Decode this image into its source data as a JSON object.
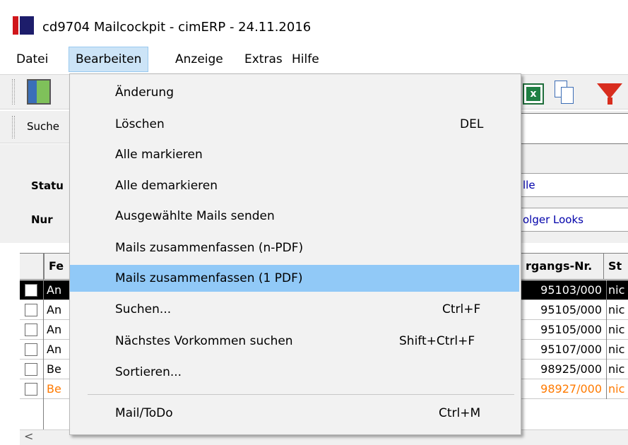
{
  "window": {
    "title": "cd9704 Mailcockpit - cimERP - 24.11.2016"
  },
  "menubar": {
    "items": [
      "Datei",
      "Bearbeiten",
      "Anzeige",
      "Extras",
      "Hilfe"
    ],
    "active": "Bearbeiten"
  },
  "searchbar": {
    "label": "Suche"
  },
  "form": {
    "status_label": "Statu",
    "status_value": "lle",
    "nur_label": "Nur",
    "nur_value": "olger Looks"
  },
  "grid": {
    "columns": [
      "Fe",
      "rgangs-Nr.",
      "St"
    ],
    "rows": [
      {
        "col1": "An",
        "vorgang": "95103/000",
        "status": "nic",
        "style": "selected"
      },
      {
        "col1": "An",
        "vorgang": "95105/000",
        "status": "nic",
        "style": "normal"
      },
      {
        "col1": "An",
        "vorgang": "95105/000",
        "status": "nic",
        "style": "normal"
      },
      {
        "col1": "An",
        "vorgang": "95107/000",
        "status": "nic",
        "style": "normal"
      },
      {
        "col1": "Be",
        "vorgang": "98925/000",
        "status": "nic",
        "style": "normal"
      },
      {
        "col1": "Be",
        "vorgang": "98927/000",
        "status": "nic",
        "style": "orange"
      }
    ],
    "scroll_arrow": "<"
  },
  "dropdown": {
    "items": [
      {
        "label": "Änderung",
        "shortcut": ""
      },
      {
        "label": "Löschen",
        "shortcut": "DEL"
      },
      {
        "label": "Alle markieren",
        "shortcut": ""
      },
      {
        "label": "Alle demarkieren",
        "shortcut": ""
      },
      {
        "label": "Ausgewählte Mails senden",
        "shortcut": ""
      },
      {
        "label": "Mails zusammenfassen (n-PDF)",
        "shortcut": ""
      },
      {
        "label": "Mails zusammenfassen (1 PDF)",
        "shortcut": ""
      },
      {
        "label": "Suchen...",
        "shortcut": "Ctrl+F"
      },
      {
        "label": "Nächstes Vorkommen suchen",
        "shortcut": "Shift+Ctrl+F"
      },
      {
        "label": "Sortieren...",
        "shortcut": ""
      },
      {
        "label": "Mail/ToDo",
        "shortcut": "Ctrl+M"
      }
    ],
    "highlighted": "Mails zusammenfassen (1 PDF)"
  },
  "colors": {
    "menu_highlight": "#91c9f7",
    "menubar_active": "#cce4f7",
    "row_selected": "#000000",
    "row_orange": "#ff7a00"
  },
  "icons": [
    "app-logo-icon",
    "exit-door-icon",
    "excel-export-icon",
    "copy-icon",
    "filter-funnel-icon"
  ]
}
